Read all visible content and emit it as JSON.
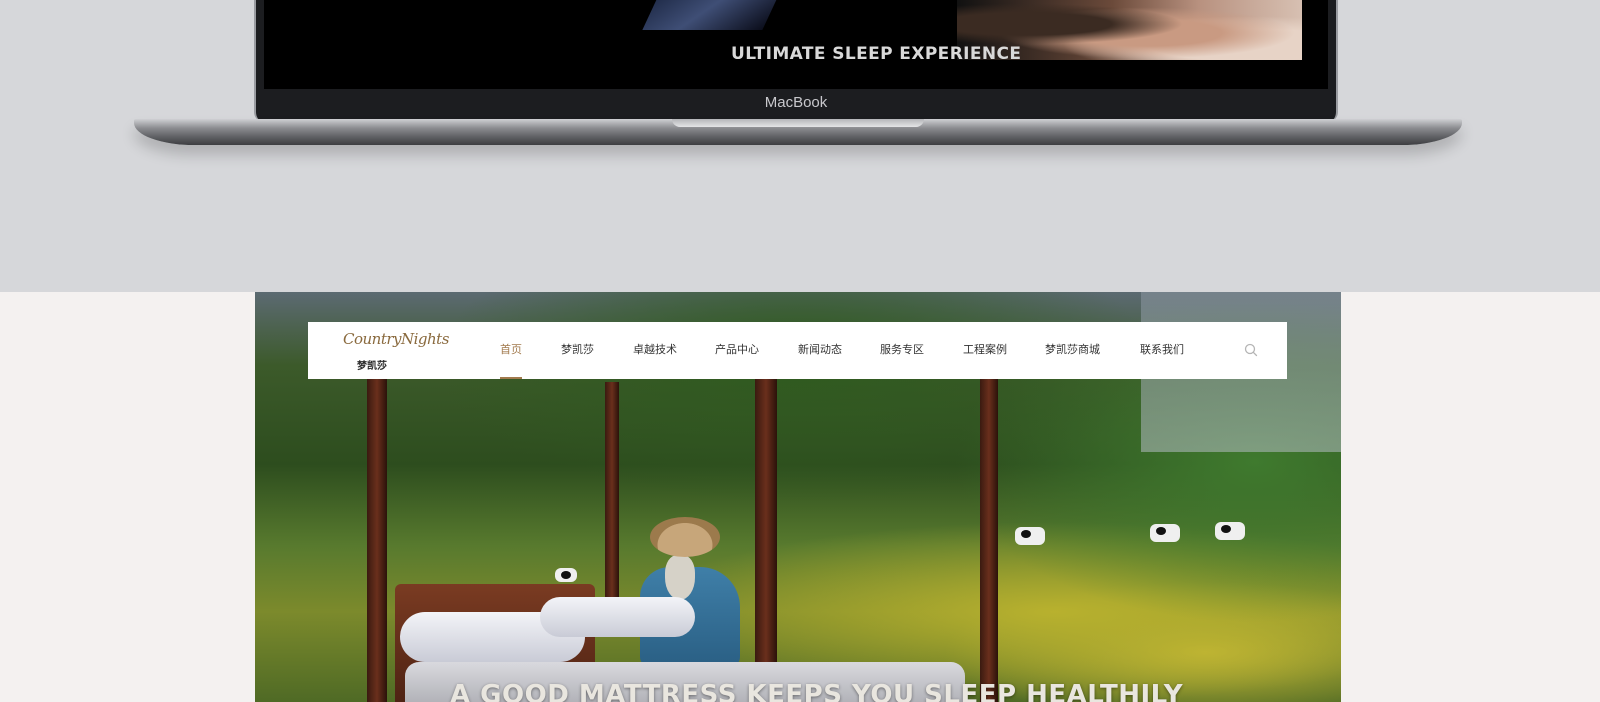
{
  "mockup": {
    "screen_headline": "ULTIMATE SLEEP EXPERIENCE",
    "laptop_brand": "MacBook"
  },
  "site": {
    "logo": {
      "script": "CountryNights",
      "cn": "梦凯莎"
    },
    "nav": {
      "items": [
        {
          "label": "首页",
          "active": true
        },
        {
          "label": "梦凯莎",
          "active": false
        },
        {
          "label": "卓越技术",
          "active": false
        },
        {
          "label": "产品中心",
          "active": false
        },
        {
          "label": "新闻动态",
          "active": false
        },
        {
          "label": "服务专区",
          "active": false
        },
        {
          "label": "工程案例",
          "active": false
        },
        {
          "label": "梦凯莎商城",
          "active": false
        },
        {
          "label": "联系我们",
          "active": false
        }
      ],
      "search_icon": "search-icon"
    },
    "hero_text": "A GOOD MATTRESS KEEPS YOU SLEEP HEALTHILY"
  },
  "colors": {
    "accent": "#a27a4d",
    "mock_background": "#d6d7da",
    "page_background": "#f4f1f0"
  }
}
